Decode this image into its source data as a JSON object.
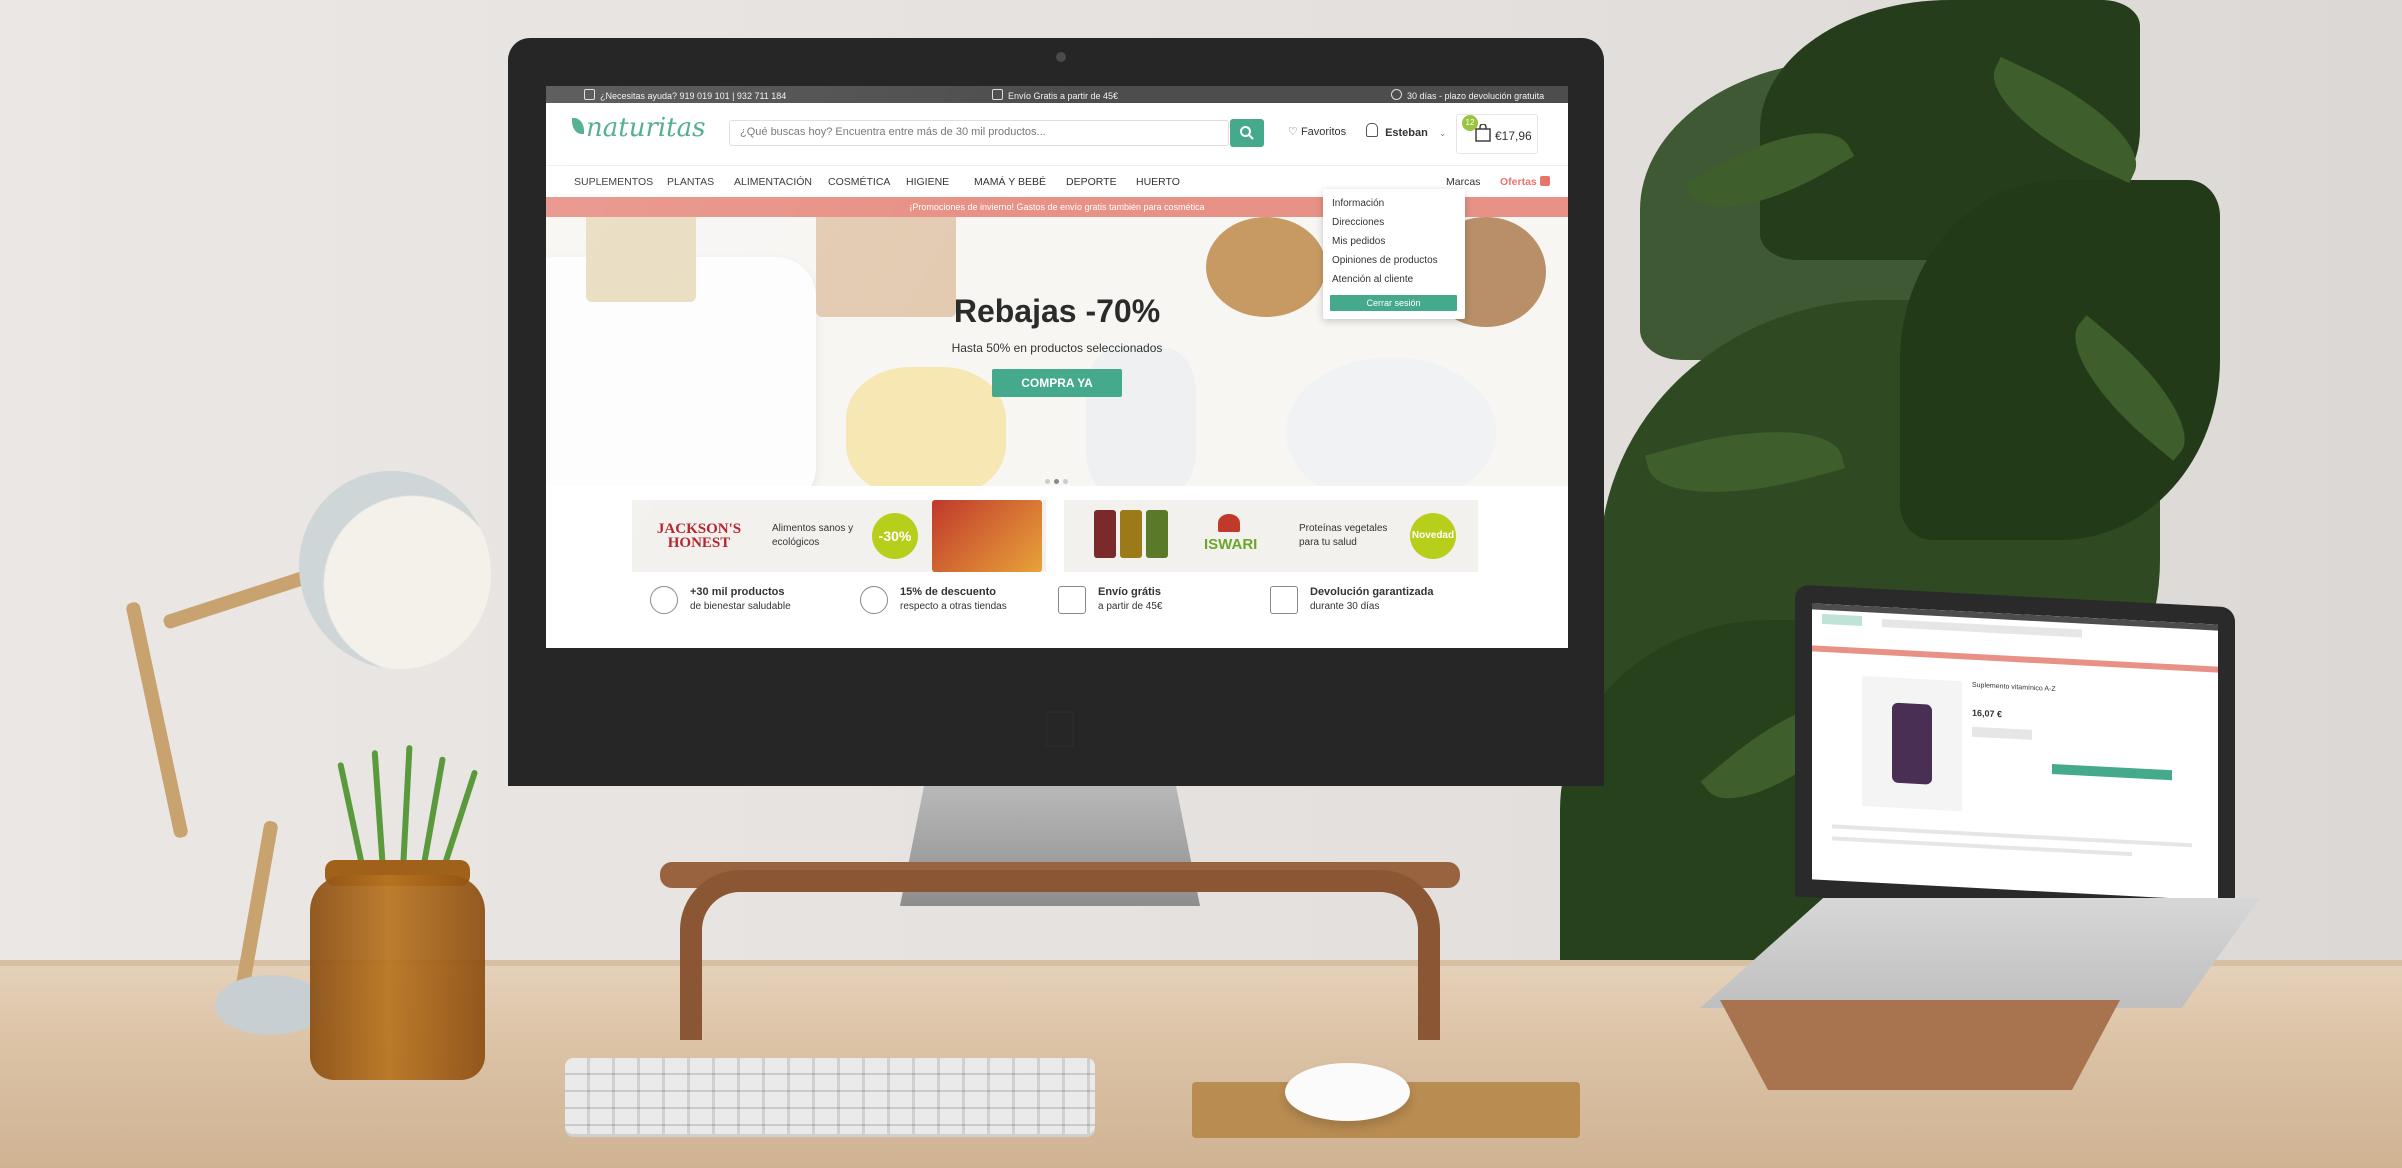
{
  "topbar": {
    "help": "¿Necesitas ayuda? 919 019 101 | 932 711 184",
    "shipping": "Envío Gratis a partir de 45€",
    "returns": "30 días - plazo devolución gratuita"
  },
  "header": {
    "logo": "naturitas",
    "search_placeholder": "¿Qué buscas hoy? Encuentra entre más de 30 mil productos...",
    "favorites": "Favoritos",
    "user": "Esteban",
    "cart_count": "12",
    "cart_total": "€17,96"
  },
  "nav": {
    "items": [
      "SUPLEMENTOS",
      "PLANTAS",
      "ALIMENTACIÓN",
      "COSMÉTICA",
      "HIGIENE",
      "MAMÁ Y BEBÉ",
      "DEPORTE",
      "HUERTO"
    ],
    "brands": "Marcas",
    "offers": "Ofertas"
  },
  "promo": "¡Promociones de invierno! Gastos de envío gratis también para cosmética",
  "hero": {
    "title": "Rebajas -70%",
    "subtitle": "Hasta 50% en productos seleccionados",
    "cta": "COMPRA YA"
  },
  "banners": [
    {
      "brand": "JACKSON'S HONEST",
      "text_line1": "Alimentos sanos y",
      "text_line2": "ecológicos",
      "badge": "-30%"
    },
    {
      "brand": "ISWARI",
      "text_line1": "Proteínas vegetales",
      "text_line2": "para tu salud",
      "badge": "Novedad"
    }
  ],
  "features": [
    {
      "title": "+30 mil productos",
      "subtitle": "de bienestar saludable"
    },
    {
      "title": "15% de descuento",
      "subtitle": "respecto a otras tiendas"
    },
    {
      "title": "Envío grátis",
      "subtitle": "a partir de 45€"
    },
    {
      "title": "Devolución garantizada",
      "subtitle": "durante 30 días"
    }
  ],
  "dropdown": {
    "items": [
      "Información",
      "Direcciones",
      "Mis pedidos",
      "Opiniones de productos",
      "Atención al cliente"
    ],
    "logout": "Cerrar sesión"
  },
  "laptop": {
    "product_title": "Suplemento vitamínico A-Z",
    "price": "16,07 €"
  },
  "colors": {
    "brand_green": "#45a98b",
    "promo_pink": "#e89186",
    "offers_red": "#e8756a",
    "badge_lime": "#b7cf1a",
    "topbar": "#4d4d4d"
  }
}
